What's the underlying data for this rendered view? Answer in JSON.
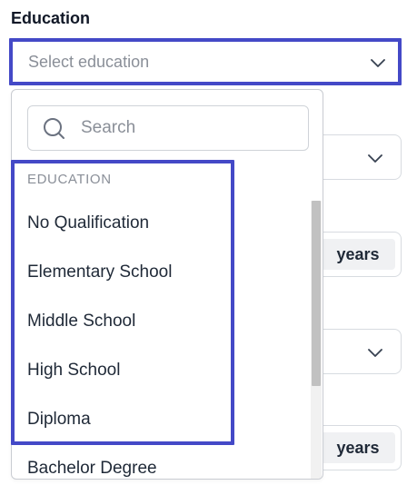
{
  "field": {
    "label": "Education",
    "placeholder": "Select education"
  },
  "search": {
    "placeholder": "Search"
  },
  "dropdown": {
    "group_header": "EDUCATION",
    "options": [
      "No Qualification",
      "Elementary School",
      "Middle School",
      "High School",
      "Diploma",
      "Bachelor Degree"
    ]
  },
  "background_fields": {
    "years_addon_1": "years",
    "years_addon_2": "years"
  },
  "colors": {
    "highlight": "#4449c7",
    "border": "#d7dbe0",
    "placeholder": "#8a8f98"
  },
  "icons": {
    "search": "search-icon",
    "chevron": "chevron-down-icon"
  }
}
